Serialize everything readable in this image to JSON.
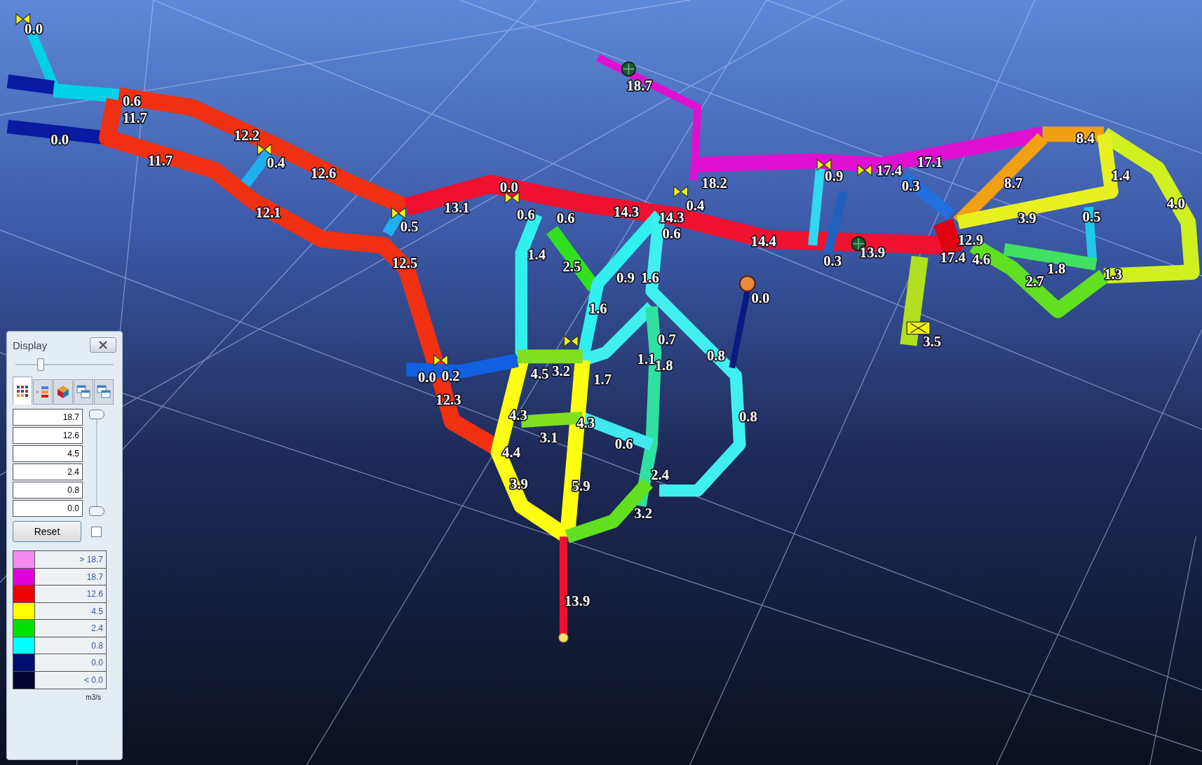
{
  "scene": {
    "flow_labels": [
      "0.0",
      "0.6",
      "11.7",
      "0.0",
      "11.7",
      "12.2",
      "0.4",
      "12.6",
      "12.1",
      "0.5",
      "13.1",
      "12.5",
      "0.0",
      "0.6",
      "0.6",
      "14.3",
      "14.3",
      "0.6",
      "0.4",
      "18.7",
      "18.2",
      "14.4",
      "0.9",
      "17.4",
      "17.1",
      "0.3",
      "8.4",
      "8.7",
      "1.4",
      "3.9",
      "0.5",
      "4.0",
      "12.9",
      "17.4",
      "4.6",
      "1.8",
      "2.7",
      "1.3",
      "0.3",
      "13.9",
      "0.0",
      "3.5",
      "1.4",
      "2.5",
      "0.9",
      "1.6",
      "1.6",
      "0.7",
      "1.1",
      "1.8",
      "0.8",
      "0.0",
      "0.2",
      "4.5",
      "3.2",
      "1.7",
      "12.3",
      "4.3",
      "4.3",
      "3.1",
      "0.6",
      "0.8",
      "4.4",
      "3.9",
      "5.9",
      "2.4",
      "3.2",
      "13.9"
    ]
  },
  "display_panel": {
    "title": "Display",
    "opacity_slider": {
      "level": 0.27
    },
    "tabs": [
      {
        "kind": "grid",
        "selected": true
      },
      {
        "kind": "layers",
        "selected": false
      },
      {
        "kind": "cube",
        "selected": false
      },
      {
        "kind": "windows",
        "selected": false
      },
      {
        "kind": "windows",
        "selected": false
      }
    ],
    "thresholds": [
      "18.7",
      "12.6",
      "4.5",
      "2.4",
      "0.8",
      "0.0"
    ],
    "range_thumbs": [
      {
        "level": 1
      },
      {
        "level": 0
      }
    ],
    "reset_label": "Reset",
    "checkbox": {
      "checked": false
    },
    "legend": [
      {
        "color": "#f48af0",
        "label": "> 18.7"
      },
      {
        "color": "#e000d8",
        "label": "18.7"
      },
      {
        "color": "#ee0000",
        "label": "12.6"
      },
      {
        "color": "#ffff00",
        "label": "4.5"
      },
      {
        "color": "#00e000",
        "label": "2.4"
      },
      {
        "color": "#00ffff",
        "label": "0.8"
      },
      {
        "color": "#000e70",
        "label": "0.0"
      },
      {
        "color": "#040430",
        "label": "< 0.0"
      }
    ],
    "unit": "m3/s"
  }
}
